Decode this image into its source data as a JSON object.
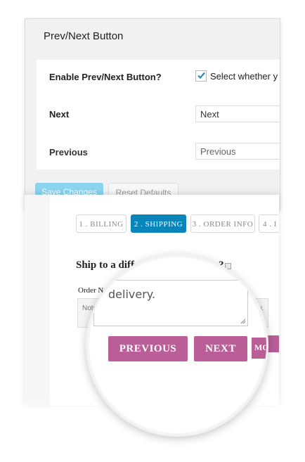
{
  "settings": {
    "title": "Prev/Next Button",
    "enable_label": "Enable Prev/Next Button?",
    "enable_checked": true,
    "enable_description": "Select whether y",
    "next_label": "Next",
    "next_value": "Next",
    "previous_label": "Previous",
    "previous_value": "Previous",
    "save_label": "Save Changes",
    "reset_label": "Reset Defaults"
  },
  "checkout": {
    "steps": [
      {
        "label": "1 . BILLING",
        "active": false
      },
      {
        "label": "2 . SHIPPING",
        "active": true
      },
      {
        "label": "3 . ORDER INFO",
        "active": false
      },
      {
        "label": "4 . I",
        "active": false
      }
    ],
    "ship_heading": "Ship to a diff",
    "ship_heading_end": "?",
    "order_label": "Order N",
    "order_placeholder_start": "Note",
    "order_placeholder_end": "ery."
  },
  "magnifier": {
    "textarea_text": "delivery.",
    "previous_label": "PREVIOUS",
    "next_label": "NEXT",
    "peek_label": "MO"
  },
  "colors": {
    "accent_blue": "#0a85ba",
    "button_pink": "#b95e97",
    "save_button": "#8ad4ee"
  }
}
